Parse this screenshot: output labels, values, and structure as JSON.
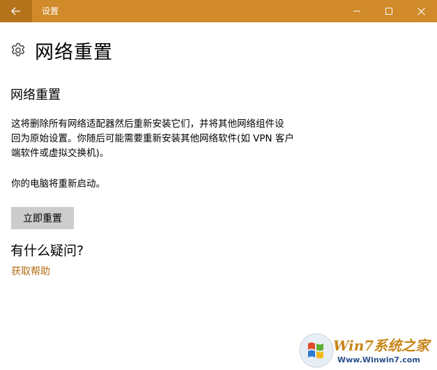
{
  "window": {
    "title": "设置",
    "controls": {
      "minimize_icon": "minimize-icon",
      "maximize_icon": "maximize-icon",
      "close_icon": "close-icon"
    }
  },
  "colors": {
    "accent": "#d08a2a",
    "accent_dark": "#b5741c",
    "link": "#b56d14",
    "button_bg": "#cccccc"
  },
  "header": {
    "icon": "gear-icon",
    "title": "网络重置"
  },
  "main": {
    "section_title": "网络重置",
    "description_lines": [
      "这将删除所有网络适配器然后重新安装它们，并将其他网络组件设",
      "回为原始设置。你随后可能需要重新安装其他网络软件(如 VPN 客户",
      "端软件或虚拟交换机)。"
    ],
    "restart_note": "你的电脑将重新启动。",
    "reset_button": "立即重置",
    "question": "有什么疑问?",
    "help_link": "获取帮助"
  },
  "watermark": {
    "brand": "Win7系统之家",
    "url": "Www.Winwin7.com"
  }
}
